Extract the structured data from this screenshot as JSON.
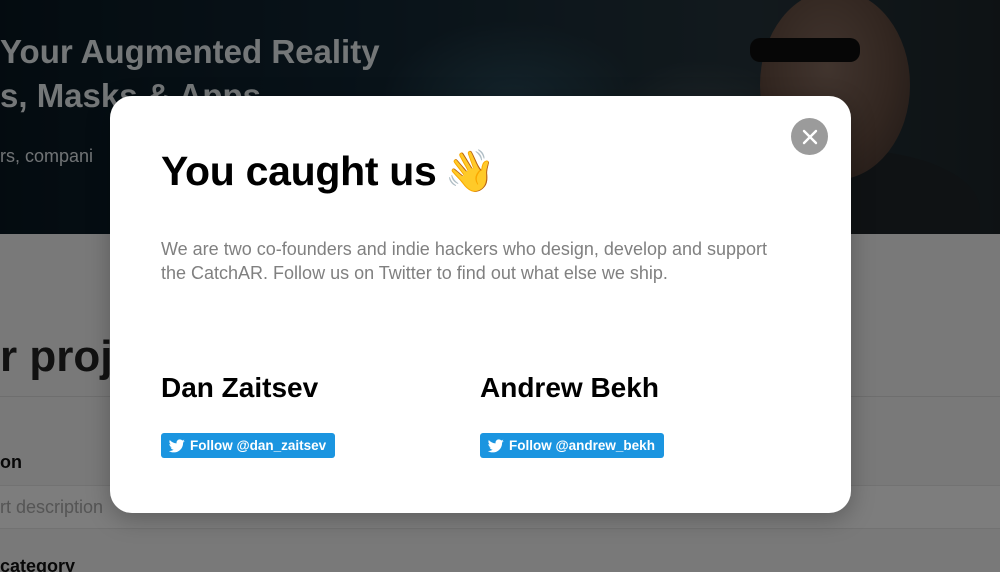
{
  "background_page": {
    "hero_title_line1": "Your Augmented Reality",
    "hero_title_line2": "s, Masks & Apps",
    "hero_subtitle": "rs, compani",
    "section_heading": "r proj",
    "description_label": "on",
    "description_placeholder": "rt description",
    "category_label": "category"
  },
  "modal": {
    "title": "You caught us",
    "title_emoji": "👋",
    "body": "We are two co-founders and indie hackers who design, develop and support the CatchAR. Follow us on Twitter to find out what else we ship.",
    "close_icon": "close-icon",
    "founders": [
      {
        "name": "Dan Zaitsev",
        "follow_label": "Follow @dan_zaitsev"
      },
      {
        "name": "Andrew Bekh",
        "follow_label": "Follow @andrew_bekh"
      }
    ]
  },
  "colors": {
    "twitter_blue": "#1b95e0",
    "close_button": "#9b9b9b",
    "body_text": "#808080"
  }
}
